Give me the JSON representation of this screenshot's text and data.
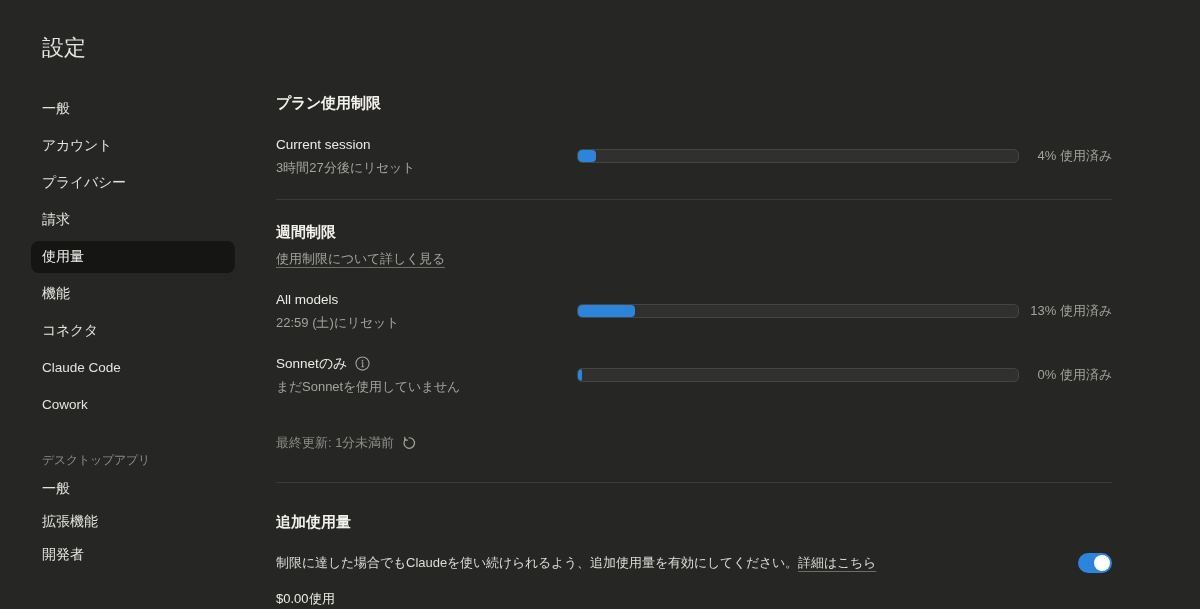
{
  "sidebar": {
    "title": "設定",
    "groups": [
      {
        "items": [
          {
            "label": "一般",
            "selected": false
          },
          {
            "label": "アカウント",
            "selected": false
          },
          {
            "label": "プライバシー",
            "selected": false
          },
          {
            "label": "請求",
            "selected": false
          },
          {
            "label": "使用量",
            "selected": true
          },
          {
            "label": "機能",
            "selected": false
          },
          {
            "label": "コネクタ",
            "selected": false
          },
          {
            "label": "Claude Code",
            "selected": false
          },
          {
            "label": "Cowork",
            "selected": false
          }
        ]
      },
      {
        "heading": "デスクトップアプリ",
        "items": [
          {
            "label": "一般",
            "selected": false
          },
          {
            "label": "拡張機能",
            "selected": false
          },
          {
            "label": "開発者",
            "selected": false
          }
        ]
      }
    ]
  },
  "plan_limits": {
    "heading": "プラン使用制限",
    "meters": [
      {
        "label": "Current session",
        "info": false,
        "sublabel": "3時間27分後にリセット",
        "level": 0.04,
        "reading": "4% 使用済み"
      }
    ]
  },
  "weekly_limits": {
    "heading": "週間制限",
    "link": "使用制限について詳しく見る",
    "meters": [
      {
        "label": "All models",
        "info": false,
        "sublabel": "22:59 (土)にリセット",
        "level": 0.13,
        "reading": "13% 使用済み"
      },
      {
        "label": "Sonnetのみ",
        "info": true,
        "sublabel": "まだSonnetを使用していません",
        "level": 0,
        "reading": "0% 使用済み"
      }
    ],
    "last_updated": "最終更新: 1分未満前"
  },
  "extra_usage": {
    "heading": "追加使用量",
    "description": "制限に達した場合でもClaudeを使い続けられるよう、追加使用量を有効にしてください。",
    "link": "詳細はこちら",
    "toggle": {
      "on": true
    },
    "usage": "$0.00使用"
  }
}
